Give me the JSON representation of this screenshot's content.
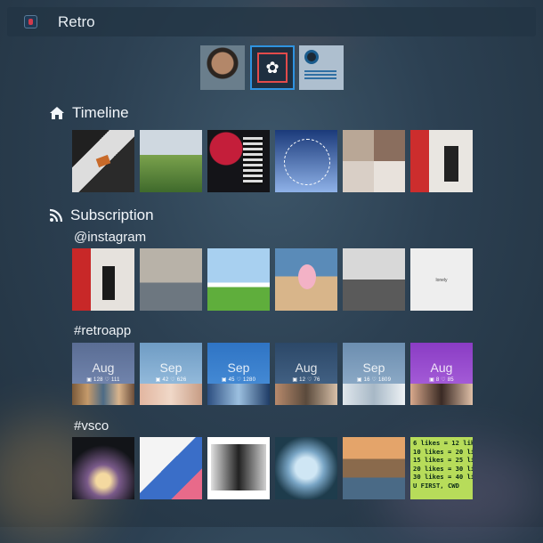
{
  "window": {
    "title": "Retro",
    "app_icon": "retro-app-icon"
  },
  "accounts": [
    {
      "name": "account-avatar-person",
      "active": false
    },
    {
      "name": "account-avatar-retro",
      "active": true,
      "icon": "flower-icon"
    },
    {
      "name": "account-avatar-blueprint",
      "active": false
    }
  ],
  "timeline": {
    "title": "Timeline",
    "icon": "home-icon"
  },
  "subscription": {
    "title": "Subscription",
    "icon": "rss-icon"
  },
  "feeds": [
    {
      "title": "@instagram"
    },
    {
      "title": "#retroapp",
      "tiles": [
        {
          "month": "Aug",
          "counts": "▣ 128 ♡ 111"
        },
        {
          "month": "Sep",
          "counts": "▣ 42 ♡ 626"
        },
        {
          "month": "Sep",
          "counts": "▣ 45 ♡ 1280"
        },
        {
          "month": "Aug",
          "counts": "▣ 12 ♡ 76"
        },
        {
          "month": "Sep",
          "counts": "▣ 16 ♡ 1809"
        },
        {
          "month": "Aug",
          "counts": "▣ 8 ♡ 85"
        }
      ]
    },
    {
      "title": "#vsco",
      "text_tile": "6 likes = 12 likes\n10 likes = 20 likes\n15 likes = 25 likes\n20 likes = 30 likes\n30 likes = 40 likes\nU FIRST, CWD"
    }
  ],
  "instagram_center_tile_text": "lonely",
  "colors": {
    "accent": "#2f93e0",
    "retro_red": "#e24b4b"
  }
}
